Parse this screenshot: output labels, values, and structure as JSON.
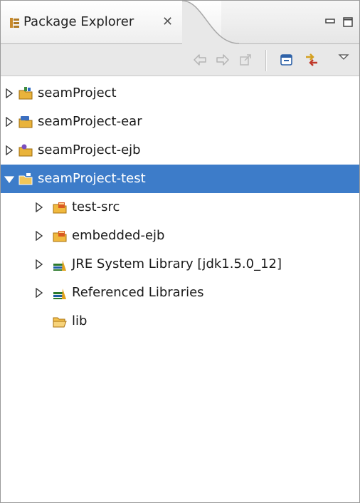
{
  "view": {
    "title": "Package Explorer",
    "close_glyph": "✕"
  },
  "toolbar": {
    "buttons": [
      {
        "name": "back-icon",
        "enabled": false
      },
      {
        "name": "forward-icon",
        "enabled": false
      },
      {
        "name": "up-icon",
        "enabled": false
      },
      {
        "name": "collapse-all-icon",
        "enabled": true
      },
      {
        "name": "link-with-editor-icon",
        "enabled": true
      },
      {
        "name": "view-menu-icon",
        "enabled": true
      }
    ]
  },
  "tree": {
    "items": [
      {
        "label": "seamProject",
        "level": 0,
        "expanded": false,
        "icon": "web-project-icon"
      },
      {
        "label": "seamProject-ear",
        "level": 0,
        "expanded": false,
        "icon": "ear-project-icon"
      },
      {
        "label": "seamProject-ejb",
        "level": 0,
        "expanded": false,
        "icon": "ejb-project-icon"
      },
      {
        "label": "seamProject-test",
        "level": 0,
        "expanded": true,
        "selected": true,
        "icon": "java-project-icon"
      },
      {
        "label": "test-src",
        "level": 1,
        "expanded": false,
        "icon": "source-folder-icon"
      },
      {
        "label": "embedded-ejb",
        "level": 1,
        "expanded": false,
        "icon": "source-folder-icon"
      },
      {
        "label": "JRE System Library [jdk1.5.0_12]",
        "level": 1,
        "expanded": false,
        "icon": "library-icon"
      },
      {
        "label": "Referenced Libraries",
        "level": 1,
        "expanded": false,
        "icon": "library-icon"
      },
      {
        "label": "lib",
        "level": 1,
        "expanded": null,
        "icon": "folder-icon"
      }
    ]
  },
  "colors": {
    "selection": "#3d7cc9",
    "folder": "#e8b43a",
    "library": "#2c7a2c"
  }
}
